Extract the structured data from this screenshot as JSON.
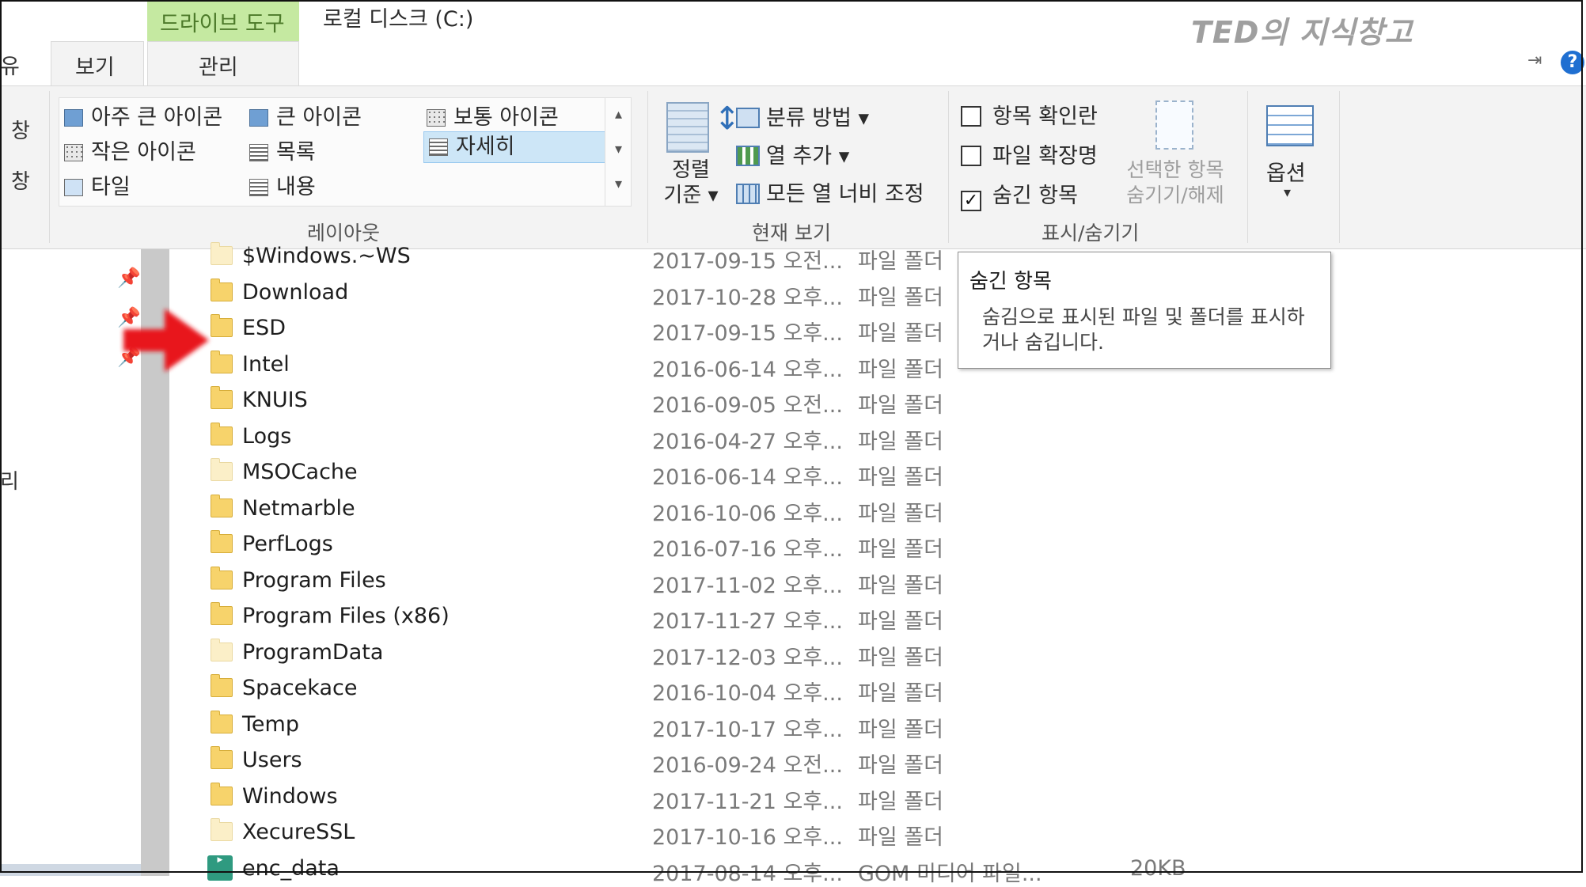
{
  "window": {
    "title": "로컬 디스크 (C:)",
    "watermark": "TED의 지식창고"
  },
  "tabs": {
    "partial_left": "유",
    "view": "보기",
    "context_group": "드라이브 도구",
    "manage": "관리"
  },
  "ribbon": {
    "pane_buttons": [
      "창",
      "창"
    ],
    "layout": {
      "label": "레이아웃",
      "items": [
        "아주 큰 아이콘",
        "큰 아이콘",
        "보통 아이콘",
        "작은 아이콘",
        "목록",
        "자세히",
        "타일",
        "내용"
      ],
      "selected": "자세히"
    },
    "current_view": {
      "label": "현재 보기",
      "sort_by": [
        "정렬",
        "기준"
      ],
      "group_by": "분류 방법",
      "add_columns": "열 추가",
      "size_all_columns": "모든 열 너비 조정"
    },
    "show_hide": {
      "label": "표시/숨기기",
      "item_checkboxes": {
        "label": "항목 확인란",
        "checked": false
      },
      "file_extensions": {
        "label": "파일 확장명",
        "checked": false
      },
      "hidden_items": {
        "label": "숨긴 항목",
        "checked": true
      },
      "hide_selected": [
        "선택한 항목",
        "숨기기/해제"
      ]
    },
    "options": "옵션"
  },
  "tooltip": {
    "title": "숨긴 항목",
    "body": "숨김으로 표시된 파일 및 폴더를 표시하거나 숨깁니다."
  },
  "nav": {
    "partial_label": "리"
  },
  "files": [
    {
      "name": "$Windows.~WS",
      "date": "2017-09-15 오전...",
      "type": "파일 폴더",
      "size": "",
      "hidden": true,
      "icon": "folder-icon"
    },
    {
      "name": "Download",
      "date": "2017-10-28 오후...",
      "type": "파일 폴더",
      "size": "",
      "hidden": false,
      "icon": "folder-icon"
    },
    {
      "name": "ESD",
      "date": "2017-09-15 오후...",
      "type": "파일 폴더",
      "size": "",
      "hidden": false,
      "icon": "folder-icon"
    },
    {
      "name": "Intel",
      "date": "2016-06-14 오후...",
      "type": "파일 폴더",
      "size": "",
      "hidden": false,
      "icon": "folder-icon"
    },
    {
      "name": "KNUIS",
      "date": "2016-09-05 오전...",
      "type": "파일 폴더",
      "size": "",
      "hidden": false,
      "icon": "folder-icon"
    },
    {
      "name": "Logs",
      "date": "2016-04-27 오후...",
      "type": "파일 폴더",
      "size": "",
      "hidden": false,
      "icon": "folder-icon"
    },
    {
      "name": "MSOCache",
      "date": "2016-06-14 오후...",
      "type": "파일 폴더",
      "size": "",
      "hidden": true,
      "icon": "folder-icon"
    },
    {
      "name": "Netmarble",
      "date": "2016-10-06 오후...",
      "type": "파일 폴더",
      "size": "",
      "hidden": false,
      "icon": "folder-icon"
    },
    {
      "name": "PerfLogs",
      "date": "2016-07-16 오후...",
      "type": "파일 폴더",
      "size": "",
      "hidden": false,
      "icon": "folder-icon"
    },
    {
      "name": "Program Files",
      "date": "2017-11-02 오후...",
      "type": "파일 폴더",
      "size": "",
      "hidden": false,
      "icon": "folder-icon"
    },
    {
      "name": "Program Files (x86)",
      "date": "2017-11-27 오후...",
      "type": "파일 폴더",
      "size": "",
      "hidden": false,
      "icon": "folder-icon"
    },
    {
      "name": "ProgramData",
      "date": "2017-12-03 오후...",
      "type": "파일 폴더",
      "size": "",
      "hidden": true,
      "icon": "folder-icon"
    },
    {
      "name": "Spacekace",
      "date": "2016-10-04 오후...",
      "type": "파일 폴더",
      "size": "",
      "hidden": false,
      "icon": "folder-icon"
    },
    {
      "name": "Temp",
      "date": "2017-10-17 오후...",
      "type": "파일 폴더",
      "size": "",
      "hidden": false,
      "icon": "folder-icon"
    },
    {
      "name": "Users",
      "date": "2016-09-24 오전...",
      "type": "파일 폴더",
      "size": "",
      "hidden": false,
      "icon": "folder-icon"
    },
    {
      "name": "Windows",
      "date": "2017-11-21 오후...",
      "type": "파일 폴더",
      "size": "",
      "hidden": false,
      "icon": "folder-icon"
    },
    {
      "name": "XecureSSL",
      "date": "2017-10-16 오후...",
      "type": "파일 폴더",
      "size": "",
      "hidden": true,
      "icon": "folder-icon"
    },
    {
      "name": "enc_data",
      "date": "2017-08-14 오후...",
      "type": "GOM 미디어 파일...",
      "size": "20KB",
      "hidden": false,
      "icon": "media-file-icon"
    }
  ],
  "colors": {
    "context_tab": "#c5e9a1",
    "selection": "#cde6f7",
    "folder": "#f7d36b",
    "arrow": "#e8141a"
  }
}
